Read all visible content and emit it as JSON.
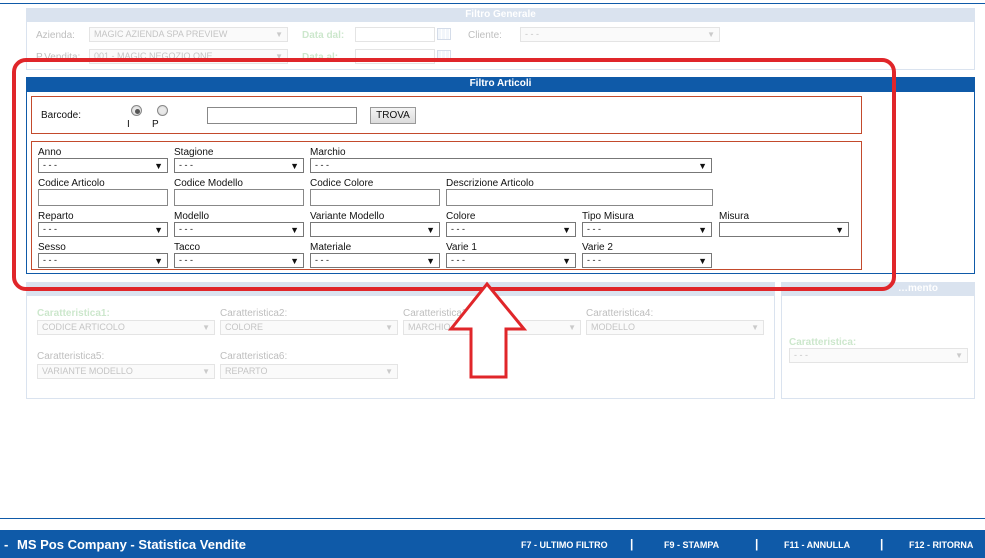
{
  "general_filter": {
    "title": "Filtro Generale",
    "azienda_label": "Azienda:",
    "azienda_value": "MAGIC AZIENDA SPA PREVIEW",
    "pvendita_label": "P.Vendita:",
    "pvendita_value": "001 - MAGIC NEGOZIO ONE",
    "data_dal_label": "Data dal:",
    "data_al_label": "Data al:",
    "cliente_label": "Cliente:",
    "cliente_value": "- - -"
  },
  "article_filter": {
    "title": "Filtro Articoli",
    "barcode_label": "Barcode:",
    "radio_i": "I",
    "radio_p": "P",
    "barcode_value": "",
    "find_button": "TROVA",
    "fields": {
      "anno": {
        "label": "Anno",
        "value": "- - -"
      },
      "stagione": {
        "label": "Stagione",
        "value": "- - -"
      },
      "marchio": {
        "label": "Marchio",
        "value": "- - -"
      },
      "codice_articolo": {
        "label": "Codice Articolo",
        "value": ""
      },
      "codice_modello": {
        "label": "Codice Modello",
        "value": ""
      },
      "codice_colore": {
        "label": "Codice Colore",
        "value": ""
      },
      "descrizione_articolo": {
        "label": "Descrizione Articolo",
        "value": ""
      },
      "reparto": {
        "label": "Reparto",
        "value": "- - -"
      },
      "modello": {
        "label": "Modello",
        "value": "- - -"
      },
      "variante_modello": {
        "label": "Variante Modello",
        "value": ""
      },
      "colore": {
        "label": "Colore",
        "value": "- - -"
      },
      "tipo_misura": {
        "label": "Tipo Misura",
        "value": "- - -"
      },
      "misura": {
        "label": "Misura",
        "value": ""
      },
      "sesso": {
        "label": "Sesso",
        "value": "- - -"
      },
      "tacco": {
        "label": "Tacco",
        "value": "- - -"
      },
      "materiale": {
        "label": "Materiale",
        "value": "- - -"
      },
      "varie1": {
        "label": "Varie 1",
        "value": "- - -"
      },
      "varie2": {
        "label": "Varie 2",
        "value": "- - -"
      }
    }
  },
  "characteristics": {
    "c1_label": "Caratteristica1:",
    "c1_value": "CODICE ARTICOLO",
    "c2_label": "Caratteristica2:",
    "c2_value": "COLORE",
    "c3_label": "Caratteristica3:",
    "c3_value": "MARCHIO",
    "c4_label": "Caratteristica4:",
    "c4_value": "MODELLO",
    "c5_label": "Caratteristica5:",
    "c5_value": "VARIANTE MODELLO",
    "c6_label": "Caratteristica6:",
    "c6_value": "REPARTO",
    "right_title": "…mento",
    "right_label": "Caratteristica:",
    "right_value": "- - -"
  },
  "footer": {
    "title": "MS Pos Company - Statistica Vendite",
    "f7": "F7 - ULTIMO FILTRO",
    "f9": "F9 - STAMPA",
    "f11": "F11 - ANNULLA",
    "f12": "F12 - RITORNA",
    "sep": "|"
  },
  "colors": {
    "accent_blue": "#0f5aa8",
    "highlight_red": "#e0262a",
    "box_border": "#c34a2c"
  }
}
